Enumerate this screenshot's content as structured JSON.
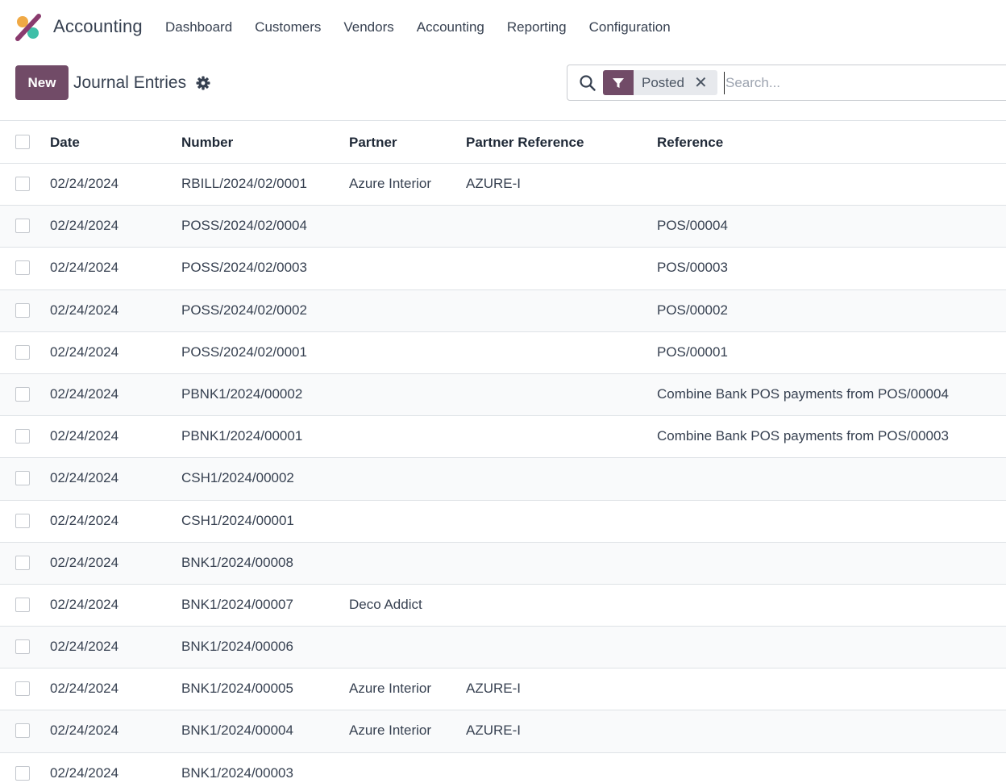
{
  "navbar": {
    "app_name": "Accounting",
    "menu": [
      "Dashboard",
      "Customers",
      "Vendors",
      "Accounting",
      "Reporting",
      "Configuration"
    ]
  },
  "control_panel": {
    "new_label": "New",
    "title": "Journal Entries"
  },
  "search": {
    "facet_label": "Posted",
    "placeholder": "Search..."
  },
  "colors": {
    "brand": "#714b67",
    "facet_bg": "#e7e9ed"
  },
  "table": {
    "columns": [
      "Date",
      "Number",
      "Partner",
      "Partner Reference",
      "Reference"
    ],
    "rows": [
      {
        "date": "02/24/2024",
        "number": "RBILL/2024/02/0001",
        "partner": "Azure Interior",
        "partner_ref": "AZURE-I",
        "reference": ""
      },
      {
        "date": "02/24/2024",
        "number": "POSS/2024/02/0004",
        "partner": "",
        "partner_ref": "",
        "reference": "POS/00004"
      },
      {
        "date": "02/24/2024",
        "number": "POSS/2024/02/0003",
        "partner": "",
        "partner_ref": "",
        "reference": "POS/00003"
      },
      {
        "date": "02/24/2024",
        "number": "POSS/2024/02/0002",
        "partner": "",
        "partner_ref": "",
        "reference": "POS/00002"
      },
      {
        "date": "02/24/2024",
        "number": "POSS/2024/02/0001",
        "partner": "",
        "partner_ref": "",
        "reference": "POS/00001"
      },
      {
        "date": "02/24/2024",
        "number": "PBNK1/2024/00002",
        "partner": "",
        "partner_ref": "",
        "reference": "Combine Bank POS payments from POS/00004"
      },
      {
        "date": "02/24/2024",
        "number": "PBNK1/2024/00001",
        "partner": "",
        "partner_ref": "",
        "reference": "Combine Bank POS payments from POS/00003"
      },
      {
        "date": "02/24/2024",
        "number": "CSH1/2024/00002",
        "partner": "",
        "partner_ref": "",
        "reference": ""
      },
      {
        "date": "02/24/2024",
        "number": "CSH1/2024/00001",
        "partner": "",
        "partner_ref": "",
        "reference": ""
      },
      {
        "date": "02/24/2024",
        "number": "BNK1/2024/00008",
        "partner": "",
        "partner_ref": "",
        "reference": ""
      },
      {
        "date": "02/24/2024",
        "number": "BNK1/2024/00007",
        "partner": "Deco Addict",
        "partner_ref": "",
        "reference": ""
      },
      {
        "date": "02/24/2024",
        "number": "BNK1/2024/00006",
        "partner": "",
        "partner_ref": "",
        "reference": ""
      },
      {
        "date": "02/24/2024",
        "number": "BNK1/2024/00005",
        "partner": "Azure Interior",
        "partner_ref": "AZURE-I",
        "reference": ""
      },
      {
        "date": "02/24/2024",
        "number": "BNK1/2024/00004",
        "partner": "Azure Interior",
        "partner_ref": "AZURE-I",
        "reference": ""
      },
      {
        "date": "02/24/2024",
        "number": "BNK1/2024/00003",
        "partner": "",
        "partner_ref": "",
        "reference": ""
      }
    ]
  }
}
